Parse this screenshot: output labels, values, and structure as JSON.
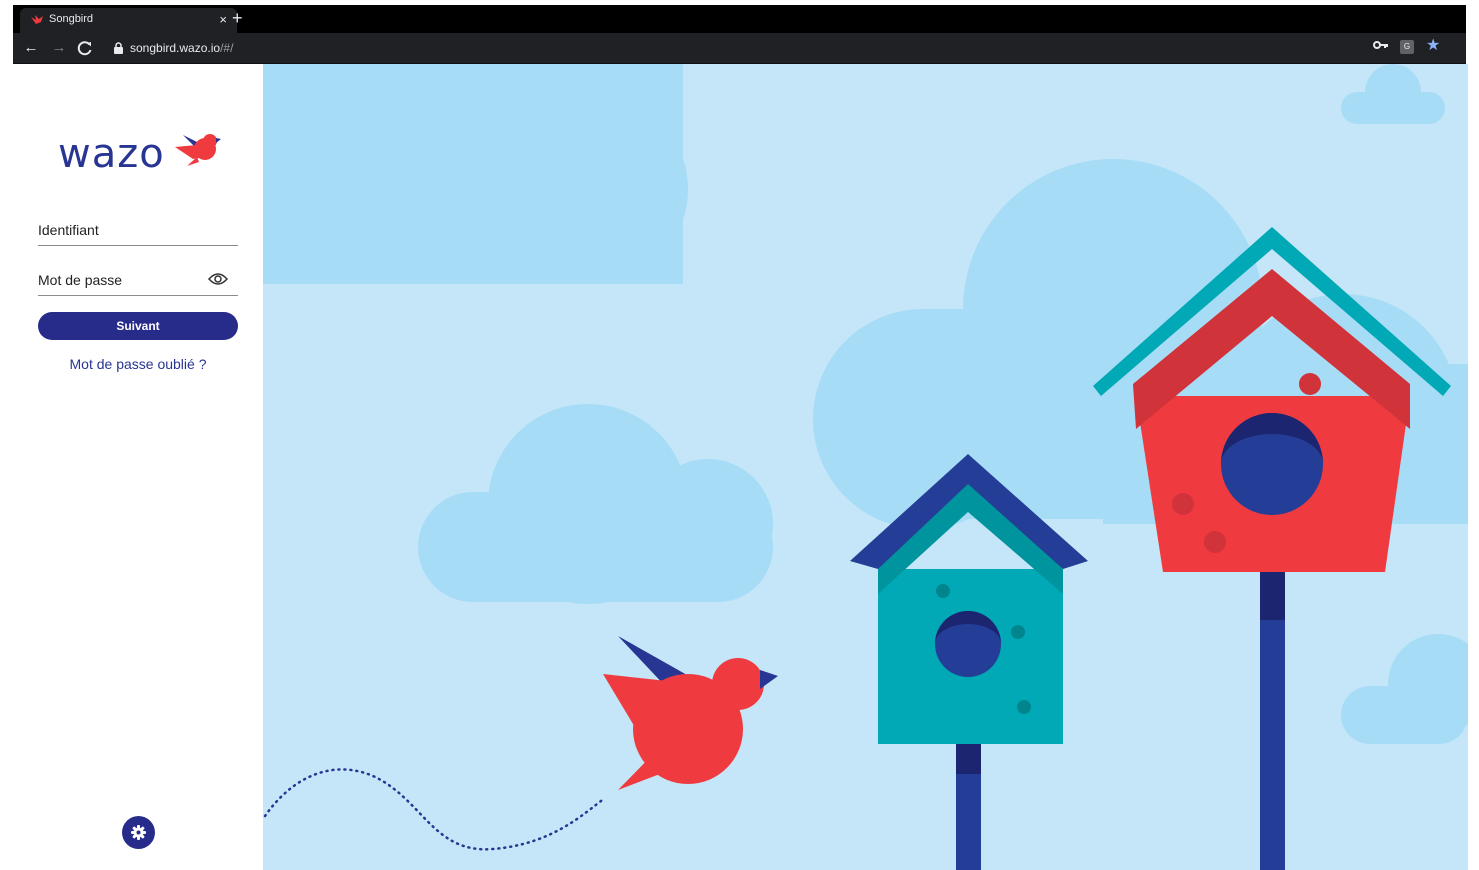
{
  "browser": {
    "tab_title": "Songbird",
    "tab_close": "×",
    "new_tab": "+",
    "url_host": "songbird.wazo.io",
    "url_path": "/#/",
    "icons": [
      "back-icon",
      "forward-icon",
      "reload-icon",
      "lock-icon",
      "key-icon",
      "translate-icon",
      "star-icon"
    ]
  },
  "login": {
    "logo_text": "wazo",
    "username_placeholder": "Identifiant",
    "password_placeholder": "Mot de passe",
    "submit_label": "Suivant",
    "forgot_label": "Mot de passe oublié ?"
  },
  "colors": {
    "brand_navy": "#272c8b",
    "brand_red": "#ef3b3f",
    "sky": "#c4e6f8",
    "cloud": "#a7dcf6",
    "teal": "#00a9b5"
  }
}
